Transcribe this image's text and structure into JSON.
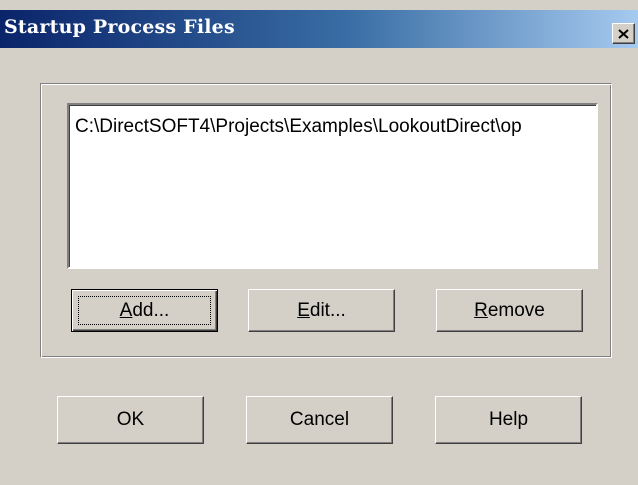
{
  "window": {
    "title": "Startup Process Files",
    "close_icon": "close-icon"
  },
  "list": {
    "items": [
      "C:\\DirectSOFT4\\Projects\\Examples\\LookoutDirect\\op"
    ]
  },
  "buttons": {
    "add": {
      "label": "Add...",
      "accel": "A",
      "rest": "dd..."
    },
    "edit": {
      "label": "Edit...",
      "accel": "E",
      "rest": "dit..."
    },
    "remove": {
      "label": "Remove",
      "accel": "R",
      "rest": "emove"
    },
    "ok": "OK",
    "cancel": "Cancel",
    "help": "Help"
  },
  "colors": {
    "face": "#d4d0c8",
    "title_start": "#0a246a",
    "title_end": "#a6caf0"
  }
}
